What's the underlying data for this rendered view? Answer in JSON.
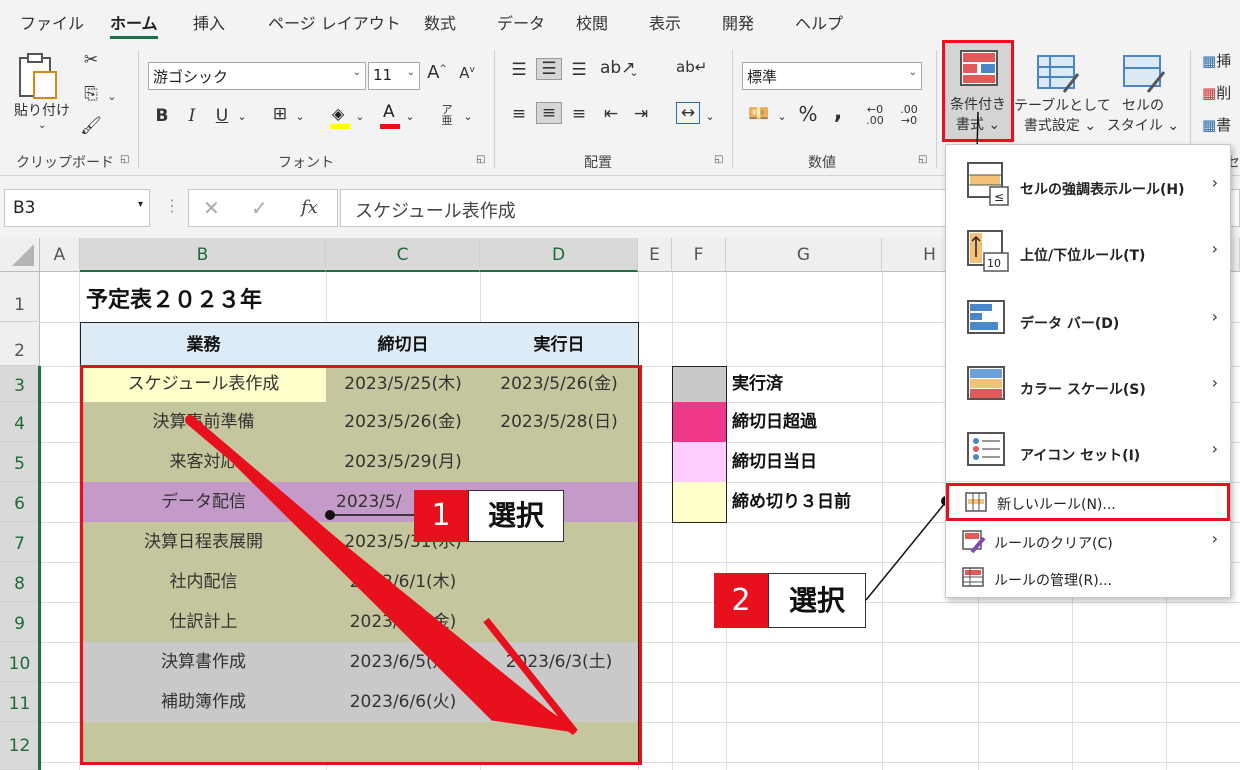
{
  "ribbon": {
    "tabs": [
      "ファイル",
      "ホーム",
      "挿入",
      "ページ レイアウト",
      "数式",
      "データ",
      "校閲",
      "表示",
      "開発",
      "ヘルプ"
    ],
    "active_tab": "ホーム",
    "groups": {
      "clipboard": "クリップボード",
      "font": "フォント",
      "alignment": "配置",
      "number": "数値"
    },
    "paste_label": "貼り付け",
    "font_name": "游ゴシック",
    "font_size": "11",
    "font_bold": "B",
    "font_italic": "I",
    "font_underline": "U",
    "number_format": "標準",
    "conditional_format": [
      "条件付き",
      "書式 ⌄"
    ],
    "format_as_table": [
      "テーブルとして",
      "書式設定 ⌄"
    ],
    "cell_styles": [
      "セルの",
      "スタイル ⌄"
    ],
    "partial_right": [
      "挿",
      "削",
      "書"
    ],
    "partial_group": "セ",
    "accent_color": "#1e7145",
    "highlight_border": "#e8101c"
  },
  "formula_bar": {
    "name_box": "B3",
    "fx": "fx",
    "content": "スケジュール表作成"
  },
  "columns": [
    "A",
    "B",
    "C",
    "D",
    "E",
    "F",
    "G",
    "H"
  ],
  "rows": [
    "1",
    "2",
    "3",
    "4",
    "5",
    "6",
    "7",
    "8",
    "9",
    "10",
    "11",
    "12"
  ],
  "sheet": {
    "title": "予定表２０２３年",
    "headers": [
      "業務",
      "締切日",
      "実行日"
    ],
    "tasks": [
      {
        "task": "スケジュール表作成",
        "deadline": "2023/5/25(木)",
        "done": "2023/5/26(金)"
      },
      {
        "task": "決算事前準備",
        "deadline": "2023/5/26(金)",
        "done": "2023/5/28(日)"
      },
      {
        "task": "来客対応",
        "deadline": "2023/5/29(月)",
        "done": ""
      },
      {
        "task": "データ配信",
        "deadline": "2023/5/",
        "done": ""
      },
      {
        "task": "決算日程表展開",
        "deadline": "2023/5/31(水)",
        "done": ""
      },
      {
        "task": "社内配信",
        "deadline": "2023/6/1(木)",
        "done": ""
      },
      {
        "task": "仕訳計上",
        "deadline": "2023/6/2(金)",
        "done": ""
      },
      {
        "task": "決算書作成",
        "deadline": "2023/6/5(月)",
        "done": "2023/6/3(土)"
      },
      {
        "task": "補助簿作成",
        "deadline": "2023/6/6(火)",
        "done": ""
      },
      {
        "task": "",
        "deadline": "",
        "done": ""
      }
    ],
    "legend": [
      {
        "label": "実行済",
        "color": "#c9c9c9"
      },
      {
        "label": "締切日超過",
        "color": "#f0388a"
      },
      {
        "label": "締切日当日",
        "color": "#ffccff"
      },
      {
        "label": "締め切り３日前",
        "color": "#ffffcc"
      }
    ],
    "colors": {
      "header_fill": "#ddebf7",
      "olive": "#c6c69e",
      "pale_yellow": "#ffffcc",
      "purple": "#c49ac8",
      "gray": "#c9c9c9"
    }
  },
  "menu": {
    "items": [
      {
        "label": "セルの強調表示ルール(H)",
        "icon": "highlight-rules-icon",
        "submenu": true
      },
      {
        "label": "上位/下位ルール(T)",
        "icon": "top-bottom-icon",
        "submenu": true
      },
      {
        "label": "データ バー(D)",
        "icon": "data-bar-icon",
        "submenu": true
      },
      {
        "label": "カラー スケール(S)",
        "icon": "color-scale-icon",
        "submenu": true
      },
      {
        "label": "アイコン セット(I)",
        "icon": "icon-set-icon",
        "submenu": true
      },
      {
        "label": "新しいルール(N)...",
        "icon": "new-rule-icon",
        "submenu": false
      },
      {
        "label": "ルールのクリア(C)",
        "icon": "clear-rules-icon",
        "submenu": true
      },
      {
        "label": "ルールの管理(R)...",
        "icon": "manage-rules-icon",
        "submenu": false
      }
    ],
    "arrow": "›"
  },
  "annotations": [
    {
      "number": "1",
      "text": "選択"
    },
    {
      "number": "2",
      "text": "選択"
    }
  ]
}
